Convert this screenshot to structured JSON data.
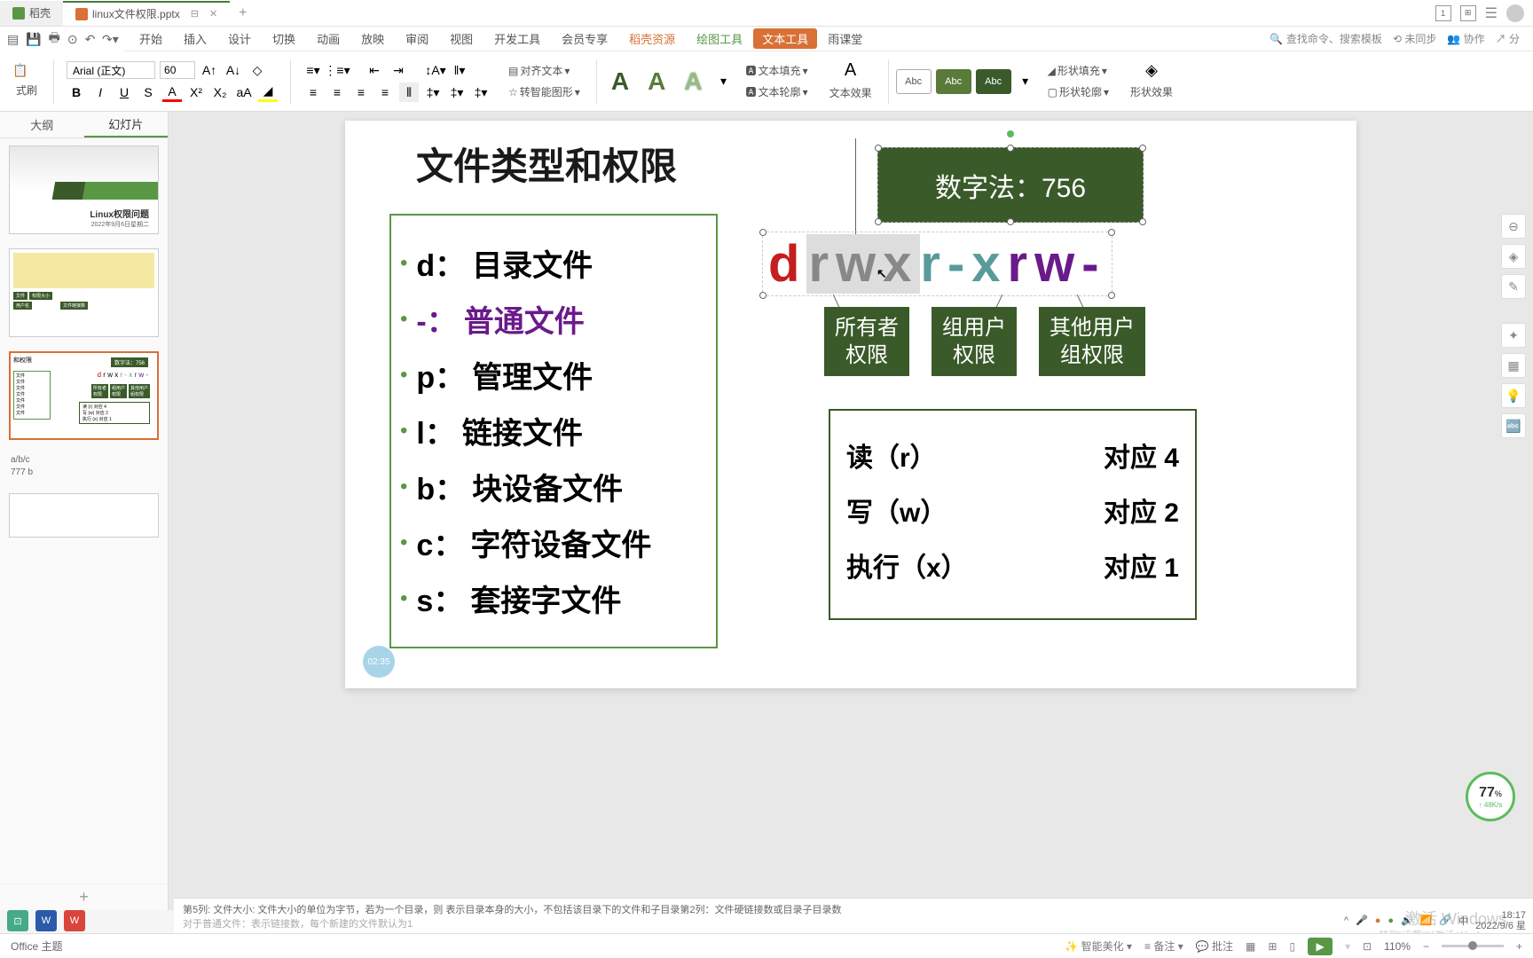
{
  "tabs": {
    "home": "稻壳",
    "active": "linux文件权限.pptx"
  },
  "menubar": {
    "items": [
      "开始",
      "插入",
      "设计",
      "切换",
      "动画",
      "放映",
      "审阅",
      "视图",
      "开发工具",
      "会员专享",
      "稻壳资源",
      "绘图工具",
      "文本工具",
      "雨课堂"
    ],
    "search_placeholder": "查找命令、搜索模板",
    "unsync": "未同步",
    "collab": "协作",
    "share": "分"
  },
  "ribbon": {
    "brush": "式刷",
    "font": "Arial (正文)",
    "size": "60",
    "align": "对齐文本",
    "smart": "转智能图形",
    "fill": "文本填充",
    "outline": "文本轮廓",
    "effect": "文本效果",
    "abc": "Abc",
    "shapefill": "形状填充",
    "shapeoutline": "形状轮廓",
    "shapeeffect": "形状效果"
  },
  "sidebar": {
    "outline": "大纲",
    "slides": "幻灯片",
    "thumb1_title": "Linux权限问题",
    "thumb1_date": "2022年9月6日星期二",
    "thumb3_title": "和权限",
    "thumb3_badge": "数字法：756",
    "notes_line1": "a/b/c",
    "notes_line2": "777  b"
  },
  "slide": {
    "title": "文件类型和权限",
    "filetypes": [
      {
        "key": "d：",
        "val": "目录文件",
        "color": "#1a1a1a"
      },
      {
        "key": "-：",
        "val": "普通文件",
        "color": "#6a1a8a"
      },
      {
        "key": "p：",
        "val": "管理文件",
        "color": "#1a1a1a"
      },
      {
        "key": "l：",
        "val": "链接文件",
        "color": "#1a1a1a"
      },
      {
        "key": "b：",
        "val": "块设备文件",
        "color": "#1a1a1a"
      },
      {
        "key": "c：",
        "val": "字符设备文件",
        "color": "#1a1a1a"
      },
      {
        "key": "s：",
        "val": "套接字文件",
        "color": "#1a1a1a"
      }
    ],
    "numeric": "数字法：756",
    "perm_d": "d",
    "perm_rwx": "rwx",
    "perm_rx": "r-x",
    "perm_rw": "rw-",
    "label_owner": "所有者\n权限",
    "label_group": "组用户\n权限",
    "label_other": "其他用户\n组权限",
    "tbl_r_lbl": "读（r）",
    "tbl_r_val": "对应  4",
    "tbl_w_lbl": "写（w）",
    "tbl_w_val": "对应  2",
    "tbl_x_lbl": "执行（x）",
    "tbl_x_val": "对应  1",
    "timer": "02:35"
  },
  "speed": {
    "val": "77",
    "unit": "%",
    "rate": "↑ 48K/s"
  },
  "notes": {
    "text": "第5列: 文件大小: 文件大小的单位为字节，若为一个目录，则 表示目录本身的大小，不包括该目录下的文件和子目录第2列：文件硬链接数或目录子目录数",
    "text2": "对于普通文件：表示链接数，每个新建的文件默认为1",
    "wm1": "激活 Windows",
    "wm2": "转到\"设置\"以激活 Windows。"
  },
  "status": {
    "theme": "Office 主题",
    "beautify": "智能美化",
    "notes": "备注",
    "comment": "批注",
    "zoom": "110%"
  },
  "tray": {
    "ime": "中",
    "time": "18:17",
    "date": "2022/9/6 星"
  }
}
